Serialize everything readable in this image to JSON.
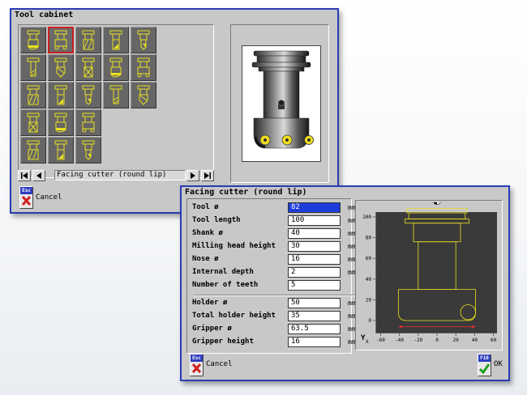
{
  "cabinet": {
    "title": "Tool cabinet",
    "selected_tool": "Facing cutter (round lip)",
    "cancel": {
      "key": "Esc",
      "label": "Cancel"
    },
    "tools": [
      "tool-1",
      "facing-cutter-round-lip",
      "tool-3",
      "tool-4",
      "tool-5",
      "tool-6",
      "tool-7",
      "tool-8",
      "tool-9",
      "tool-10",
      "tool-11",
      "tool-12",
      "tool-13",
      "tool-14",
      "tool-15",
      "tool-16",
      "tool-17",
      "tool-18",
      "tool-19",
      "tool-20",
      "tool-21"
    ]
  },
  "dialog": {
    "title": "Facing cutter (round lip)",
    "params": [
      {
        "label": "Tool ø",
        "value": "82",
        "unit": "mm"
      },
      {
        "label": "Tool length",
        "value": "100",
        "unit": "mm"
      },
      {
        "label": "Shank ø",
        "value": "40",
        "unit": "mm"
      },
      {
        "label": "Milling head height",
        "value": "30",
        "unit": "mm"
      },
      {
        "label": "Nose ø",
        "value": "16",
        "unit": "mm"
      },
      {
        "label": "Internal depth",
        "value": "2",
        "unit": "mm"
      },
      {
        "label": "Number of teeth",
        "value": "5",
        "unit": ""
      }
    ],
    "holder_params": [
      {
        "label": "Holder ø",
        "value": "50",
        "unit": "mm"
      },
      {
        "label": "Total holder height",
        "value": "35",
        "unit": "mm"
      },
      {
        "label": "Gripper ø",
        "value": "63.5",
        "unit": "mm"
      },
      {
        "label": "Gripper height",
        "value": "16",
        "unit": "mm"
      }
    ],
    "cancel": {
      "key": "Esc",
      "label": "Cancel"
    },
    "ok": {
      "key": "F10",
      "label": "OK"
    },
    "plot": {
      "y_ticks": [
        "100",
        "80",
        "60",
        "40",
        "20",
        "0"
      ],
      "x_ticks": [
        "-60",
        "-40",
        "-20",
        "0",
        "20",
        "40",
        "60"
      ],
      "y_axis_label": "Y",
      "x_axis_label": "X"
    }
  },
  "colors": {
    "window_border": "#2a3bb4",
    "tool_yellow": "#e8e020",
    "active_field": "#1e3cdc",
    "selection": "#c82020"
  }
}
